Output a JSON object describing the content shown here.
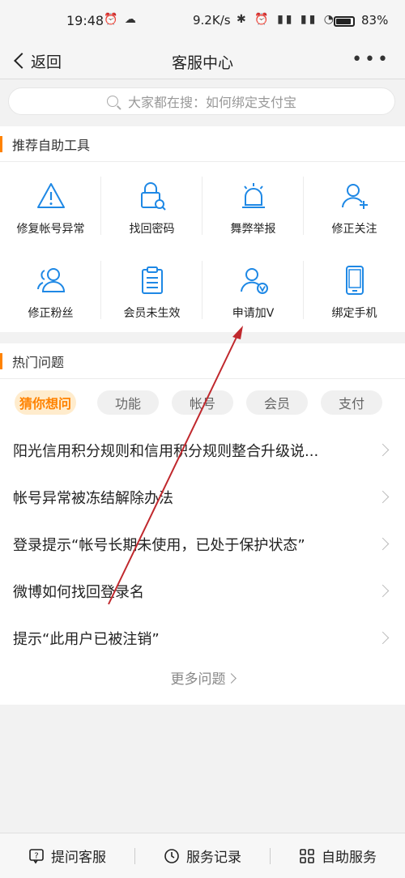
{
  "status_bar": {
    "time": "19:48",
    "network_speed": "9.2K/s",
    "battery": "83%"
  },
  "nav": {
    "back_label": "返回",
    "title": "客服中心"
  },
  "search": {
    "placeholder": "大家都在搜：如何绑定支付宝"
  },
  "tools": {
    "heading": "推荐自助工具",
    "items": [
      {
        "label": "修复帐号异常",
        "icon": "warning-icon"
      },
      {
        "label": "找回密码",
        "icon": "lock-search-icon"
      },
      {
        "label": "舞弊举报",
        "icon": "alarm-icon"
      },
      {
        "label": "修正关注",
        "icon": "user-add-icon"
      },
      {
        "label": "修正粉丝",
        "icon": "users-icon"
      },
      {
        "label": "会员未生效",
        "icon": "clipboard-icon"
      },
      {
        "label": "申请加V",
        "icon": "user-verified-icon"
      },
      {
        "label": "绑定手机",
        "icon": "phone-icon"
      }
    ]
  },
  "hot": {
    "heading": "热门问题",
    "tabs": [
      "猜你想问",
      "功能",
      "帐号",
      "会员",
      "支付"
    ],
    "active_tab": "猜你想问",
    "questions": [
      "阳光信用积分规则和信用积分规则整合升级说...",
      "帐号异常被冻结解除办法",
      "登录提示“帐号长期未使用，已处于保护状态”",
      "微博如何找回登录名",
      "提示“此用户已被注销”"
    ],
    "more_label": "更多问题"
  },
  "bottom_bar": {
    "items": [
      "提问客服",
      "服务记录",
      "自助服务"
    ]
  },
  "colors": {
    "accent": "#ff8200",
    "icon_blue": "#1e88e5",
    "annotation_arrow": "#c0282d"
  }
}
